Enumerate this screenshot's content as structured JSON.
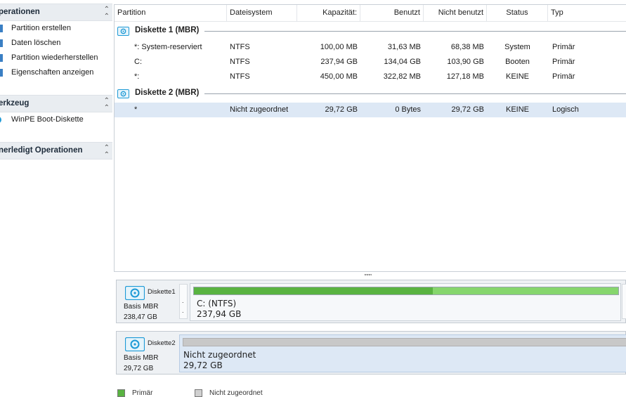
{
  "sidebar": {
    "operations": {
      "title": "perationen",
      "items": [
        {
          "label": "Partition erstellen"
        },
        {
          "label": "Daten löschen"
        },
        {
          "label": "Partition wiederherstellen"
        },
        {
          "label": "Eigenschaften anzeigen"
        }
      ]
    },
    "tools": {
      "title": "erkzeug",
      "items": [
        {
          "label": "WinPE Boot-Diskette"
        }
      ]
    },
    "pending": {
      "title": "nerledigt Operationen"
    }
  },
  "table": {
    "columns": [
      "Partition",
      "Dateisystem",
      "Kapazität:",
      "Benutzt",
      "Nicht benutzt",
      "Status",
      "Typ"
    ],
    "disks": [
      {
        "name": "Diskette 1 (MBR)",
        "rows": [
          {
            "partition": "*: System-reserviert",
            "fs": "NTFS",
            "capacity": "100,00 MB",
            "used": "31,63 MB",
            "unused": "68,38 MB",
            "status": "System",
            "type": "Primär"
          },
          {
            "partition": "C:",
            "fs": "NTFS",
            "capacity": "237,94 GB",
            "used": "134,04 GB",
            "unused": "103,90 GB",
            "status": "Booten",
            "type": "Primär"
          },
          {
            "partition": "*:",
            "fs": "NTFS",
            "capacity": "450,00 MB",
            "used": "322,82 MB",
            "unused": "127,18 MB",
            "status": "KEINE",
            "type": "Primär"
          }
        ]
      },
      {
        "name": "Diskette 2 (MBR)",
        "rows": [
          {
            "partition": "*",
            "fs": "Nicht zugeordnet",
            "capacity": "29,72 GB",
            "used": "0 Bytes",
            "unused": "29,72 GB",
            "status": "KEINE",
            "type": "Logisch"
          }
        ]
      }
    ],
    "splitter": ",,,,,,,"
  },
  "diskmap": {
    "disk1": {
      "name": "Diskette1",
      "type": "Basis MBR",
      "size": "238,47 GB",
      "mini_label_1": ".",
      "mini_label_2": ".",
      "volume": {
        "name": "C: (NTFS)",
        "size": "237,94 GB",
        "used_fraction": 0.563
      }
    },
    "disk2": {
      "name": "Diskette2",
      "type": "Basis MBR",
      "size": "29,72 GB",
      "volume": {
        "name": "Nicht zugeordnet",
        "size": "29,72 GB"
      }
    }
  },
  "legend": [
    {
      "label": "Primär",
      "color": "#59b341"
    },
    {
      "label": "Nicht zugeordnet",
      "color": "#d0d0d0"
    }
  ],
  "colors": {
    "selection": "#dde8f5",
    "used": "#59b341",
    "free": "#86d66d",
    "disk_icon": "#1e9ad6"
  }
}
